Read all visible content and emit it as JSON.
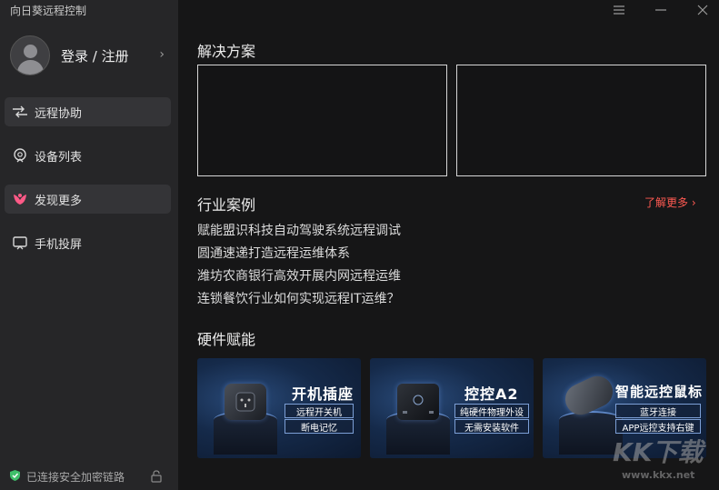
{
  "app": {
    "title": "向日葵远程控制"
  },
  "profile": {
    "login_label": "登录 / 注册"
  },
  "nav": [
    {
      "label": "远程协助",
      "icon": "remote-assist-icon"
    },
    {
      "label": "设备列表",
      "icon": "device-list-icon"
    },
    {
      "label": "发现更多",
      "icon": "discover-more-icon"
    },
    {
      "label": "手机投屏",
      "icon": "screen-cast-icon"
    }
  ],
  "footer": {
    "status": "已连接安全加密链路"
  },
  "solutions": {
    "title": "解决方案"
  },
  "cases": {
    "title": "行业案例",
    "more_label": "了解更多 ›",
    "items": [
      "赋能盟识科技自动驾驶系统远程调试",
      "圆通速递打造远程运维体系",
      "潍坊农商银行高效开展内网远程运维",
      "连锁餐饮行业如何实现远程IT运维？"
    ]
  },
  "hardware": {
    "title": "硬件赋能",
    "cards": [
      {
        "name": "开机插座",
        "tags": [
          "远程开关机",
          "断电记忆"
        ]
      },
      {
        "name": "控控A2",
        "tags": [
          "纯硬件物理外设",
          "无需安装软件"
        ]
      },
      {
        "name": "智能远控鼠标",
        "tags": [
          "蓝牙连接",
          "APP远控支持右键"
        ]
      }
    ]
  },
  "watermark": {
    "main": "KK下载",
    "url": "www.kkx.net"
  },
  "colors": {
    "accent": "#ff5a52",
    "sidebar": "#262628",
    "background": "#161617"
  }
}
